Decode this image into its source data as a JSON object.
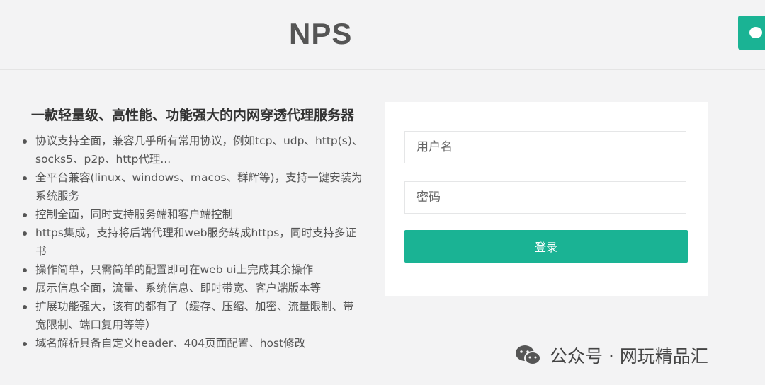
{
  "header": {
    "brand": "NPS"
  },
  "intro": {
    "tagline": "一款轻量级、高性能、功能强大的内网穿透代理服务器",
    "features": [
      "协议支持全面，兼容几乎所有常用协议，例如tcp、udp、http(s)、socks5、p2p、http代理...",
      "全平台兼容(linux、windows、macos、群辉等)，支持一键安装为系统服务",
      "控制全面，同时支持服务端和客户端控制",
      "https集成，支持将后端代理和web服务转成https，同时支持多证书",
      "操作简单，只需简单的配置即可在web ui上完成其余操作",
      "展示信息全面，流量、系统信息、即时带宽、客户端版本等",
      "扩展功能强大，该有的都有了（缓存、压缩、加密、流量限制、带宽限制、端口复用等等）",
      "域名解析具备自定义header、404页面配置、host修改"
    ]
  },
  "login": {
    "username_placeholder": "用户名",
    "password_placeholder": "密码",
    "submit_label": "登录"
  },
  "watermark": {
    "text": "公众号 · 网玩精品汇",
    "icon": "wechat-icon"
  },
  "colors": {
    "accent": "#1ab394",
    "background": "#f3f3f4",
    "card": "#ffffff"
  }
}
